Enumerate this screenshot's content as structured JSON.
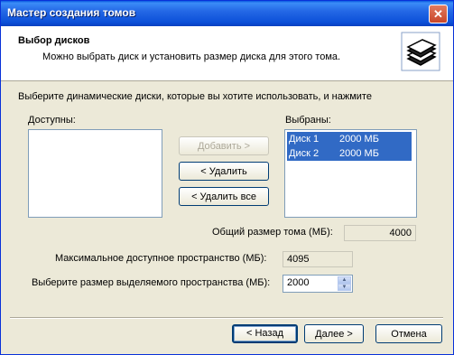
{
  "window": {
    "title": "Мастер создания томов",
    "close_glyph": "✕"
  },
  "header": {
    "title": "Выбор дисков",
    "subtitle": "Можно выбрать диск и установить размер диска для этого тома.",
    "icon": "stacked-disks-icon"
  },
  "instruction": "Выберите динамические диски, которые вы хотите использовать, и нажмите",
  "available": {
    "label": "Доступны:",
    "items": []
  },
  "selected": {
    "label": "Выбраны:",
    "items": [
      {
        "name": "Диск 1",
        "size": "2000 МБ"
      },
      {
        "name": "Диск 2",
        "size": "2000 МБ"
      }
    ]
  },
  "buttons": {
    "add": "Добавить >",
    "remove": "< Удалить",
    "remove_all": "< Удалить все",
    "back": "< Назад",
    "next": "Далее >",
    "cancel": "Отмена"
  },
  "fields": {
    "total_label": "Общий размер тома (МБ):",
    "total_value": "4000",
    "max_label": "Максимальное доступное пространство (МБ):",
    "max_value": "4095",
    "alloc_label": "Выберите размер выделяемого пространства (МБ):",
    "alloc_value": "2000"
  }
}
